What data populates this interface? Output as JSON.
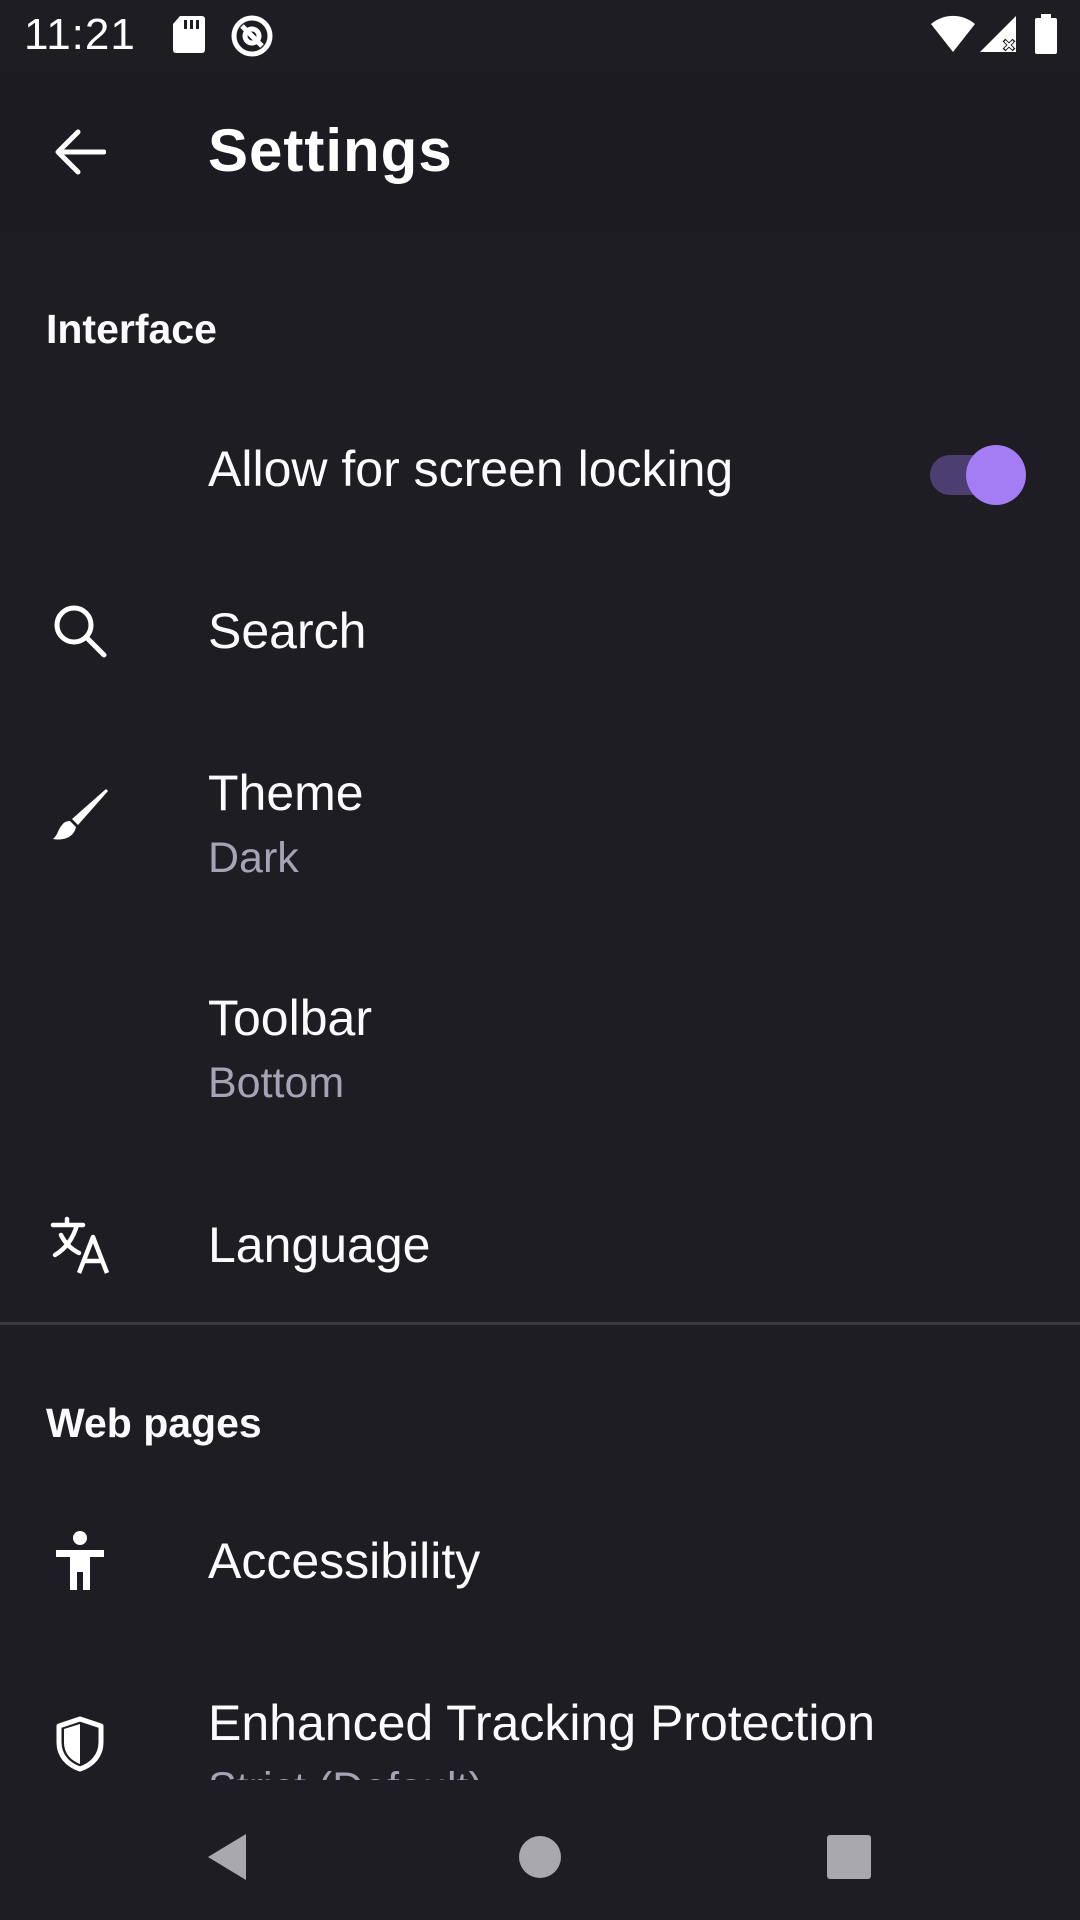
{
  "status_bar": {
    "time": "11:21",
    "icons": [
      "sd-card-icon",
      "at-sign-icon",
      "wifi-icon",
      "signal-icon",
      "battery-icon"
    ]
  },
  "app_bar": {
    "back_icon": "arrow-left-icon",
    "title": "Settings"
  },
  "interface_section": {
    "header": "Interface",
    "items": [
      {
        "title": "Allow for screen locking",
        "toggle_on": true,
        "icon": ""
      },
      {
        "title": "Search",
        "icon": "search-icon"
      },
      {
        "title": "Theme",
        "subtitle": "Dark",
        "icon": "brush-icon"
      },
      {
        "title": "Toolbar",
        "subtitle": "Bottom",
        "icon": ""
      },
      {
        "title": "Language",
        "icon": "translate-icon"
      }
    ]
  },
  "web_pages_section": {
    "header": "Web pages",
    "items": [
      {
        "title": "Accessibility",
        "icon": "accessibility-icon"
      },
      {
        "title": "Enhanced Tracking Protection",
        "subtitle": "Strict (Default)",
        "icon": "shield-icon"
      }
    ]
  },
  "nav_bar": {
    "buttons": [
      "back-triangle-icon",
      "home-circle-icon",
      "recents-square-icon"
    ]
  },
  "colors": {
    "background": "#1e1d24",
    "accent": "#a47cf4",
    "subtitle": "#a6a3b5"
  }
}
